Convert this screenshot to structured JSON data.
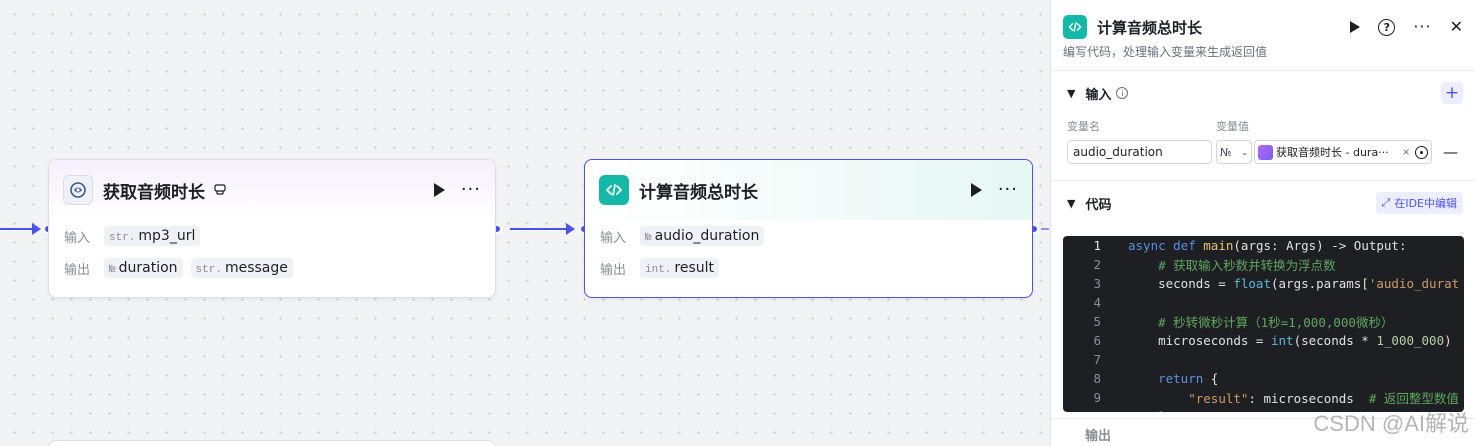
{
  "canvas": {
    "node1": {
      "title": "获取音频时长",
      "input_label": "输入",
      "output_label": "输出",
      "inputs": [
        {
          "type": "str.",
          "name": "mp3_url"
        }
      ],
      "outputs": [
        {
          "type": "№",
          "name": "duration"
        },
        {
          "type": "str.",
          "name": "message"
        }
      ]
    },
    "node2": {
      "title": "计算音频总时长",
      "input_label": "输入",
      "output_label": "输出",
      "inputs": [
        {
          "type": "№",
          "name": "audio_duration"
        }
      ],
      "outputs": [
        {
          "type": "int.",
          "name": "result"
        }
      ]
    }
  },
  "panel": {
    "title": "计算音频总时长",
    "description": "编写代码，处理输入变量来生成返回值",
    "input_section": {
      "title": "输入",
      "col_name": "变量名",
      "col_value": "变量值",
      "var_name": "audio_duration",
      "var_type": "№",
      "ref_text": "获取音频时长 - dura···",
      "ref_close": "×"
    },
    "code_section": {
      "title": "代码",
      "ide_button": "在IDE中编辑"
    },
    "next_section_title": "输出"
  },
  "code_lines": [
    "async def main(args: Args) -> Output:",
    "    # 获取输入秒数并转换为浮点数",
    "    seconds = float(args.params['audio_durat",
    "",
    "    # 秒转微秒计算（1秒=1,000,000微秒）",
    "    microseconds = int(seconds * 1_000_000)",
    "",
    "    return {",
    "        \"result\": microseconds  # 返回整型数值",
    "    }"
  ],
  "watermark": "CSDN @AI解说",
  "colors": {
    "accent": "#4d53e8",
    "code_node_icon": "#14b8a6"
  }
}
